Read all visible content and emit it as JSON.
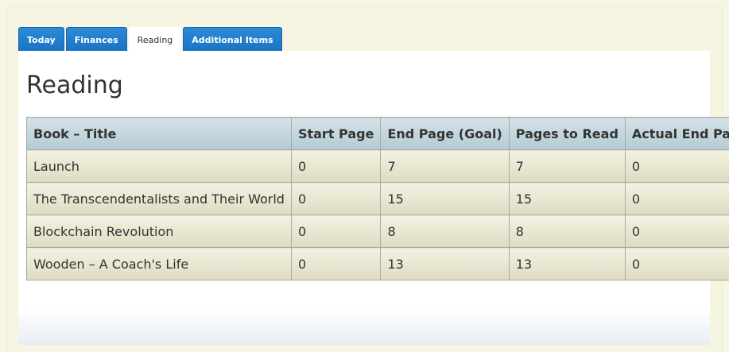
{
  "tabs": [
    {
      "label": "Today",
      "active": false
    },
    {
      "label": "Finances",
      "active": false
    },
    {
      "label": "Reading",
      "active": true
    },
    {
      "label": "Additional Items",
      "active": false
    }
  ],
  "page": {
    "title": "Reading"
  },
  "table": {
    "headers": [
      "Book – Title",
      "Start Page",
      "End Page (Goal)",
      "Pages to Read",
      "Actual End Page"
    ],
    "rows": [
      [
        "Launch",
        "0",
        "7",
        "7",
        "0"
      ],
      [
        "The Transcendentalists and Their World",
        "0",
        "15",
        "15",
        "0"
      ],
      [
        "Blockchain Revolution",
        "0",
        "8",
        "8",
        "0"
      ],
      [
        "Wooden – A Coach's Life",
        "0",
        "13",
        "13",
        "0"
      ]
    ]
  },
  "colors": {
    "tab_blue": "#1a73c4",
    "page_background": "#f7f6e4",
    "header_bg": "#c3d6de",
    "row_bg": "#e8e7d0"
  }
}
